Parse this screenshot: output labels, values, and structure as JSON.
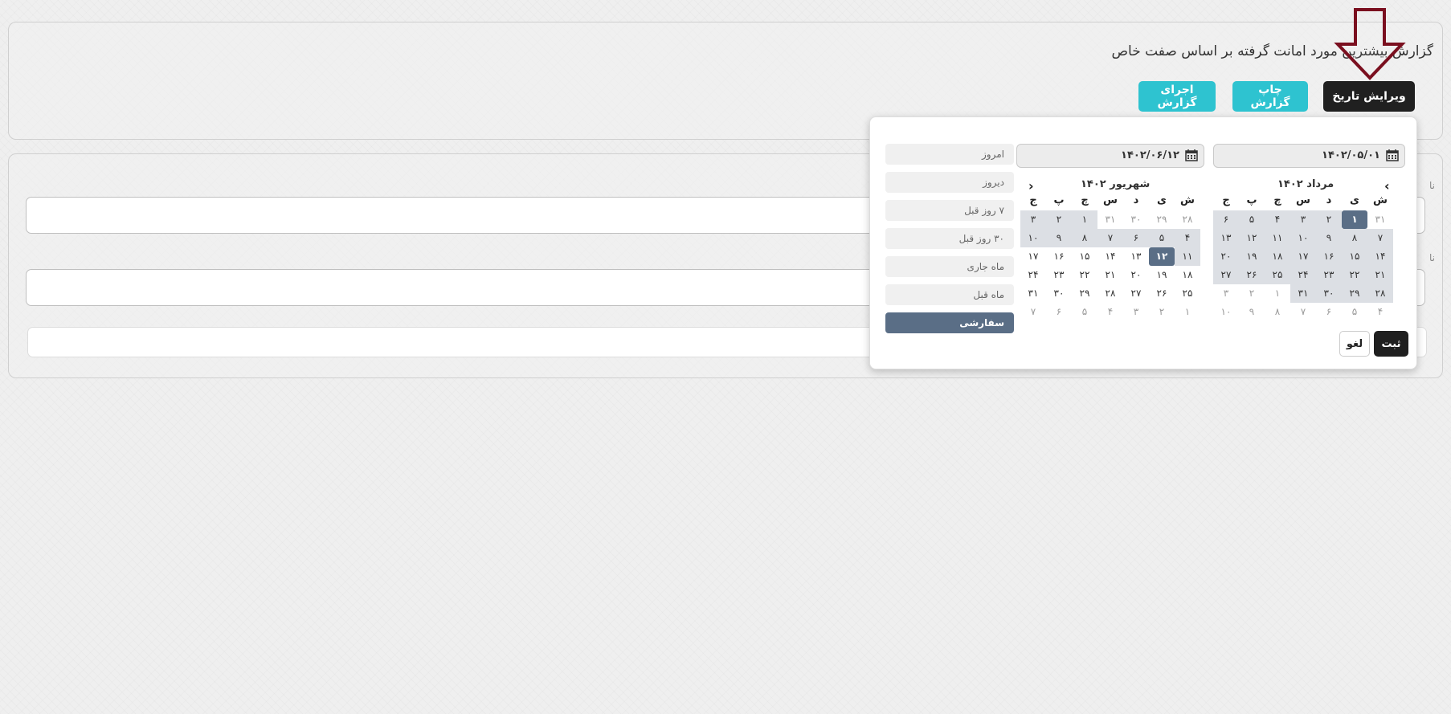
{
  "header": {
    "title": "گزارش بیشترین مورد امانت گرفته بر اساس صفت خاص"
  },
  "toolbar": {
    "edit_date_label": "ویرایش تاریخ",
    "print_label": "چاپ گزارش",
    "run_label": "اجرای گزارش"
  },
  "form": {
    "label_1": "نا",
    "label_2": "نا"
  },
  "datepicker": {
    "start_value": "۱۴۰۲/۰۵/۰۱",
    "end_value": "۱۴۰۲/۰۶/۱۲",
    "left_month_title": "مرداد ۱۴۰۲",
    "right_month_title": "شهریور ۱۴۰۲",
    "weekdays": [
      "ش",
      "ی",
      "د",
      "س",
      "چ",
      "پ",
      "ج"
    ],
    "left_month_weeks": [
      [
        "۳۱",
        "۱",
        "۲",
        "۳",
        "۴",
        "۵",
        "۶"
      ],
      [
        "۷",
        "۸",
        "۹",
        "۱۰",
        "۱۱",
        "۱۲",
        "۱۳"
      ],
      [
        "۱۴",
        "۱۵",
        "۱۶",
        "۱۷",
        "۱۸",
        "۱۹",
        "۲۰"
      ],
      [
        "۲۱",
        "۲۲",
        "۲۳",
        "۲۴",
        "۲۵",
        "۲۶",
        "۲۷"
      ],
      [
        "۲۸",
        "۲۹",
        "۳۰",
        "۳۱",
        "۱",
        "۲",
        "۳"
      ],
      [
        "۴",
        "۵",
        "۶",
        "۷",
        "۸",
        "۹",
        "۱۰"
      ]
    ],
    "right_month_weeks": [
      [
        "۲۸",
        "۲۹",
        "۳۰",
        "۳۱",
        "۱",
        "۲",
        "۳"
      ],
      [
        "۴",
        "۵",
        "۶",
        "۷",
        "۸",
        "۹",
        "۱۰"
      ],
      [
        "۱۱",
        "۱۲",
        "۱۳",
        "۱۴",
        "۱۵",
        "۱۶",
        "۱۷"
      ],
      [
        "۱۸",
        "۱۹",
        "۲۰",
        "۲۱",
        "۲۲",
        "۲۳",
        "۲۴"
      ],
      [
        "۲۵",
        "۲۶",
        "۲۷",
        "۲۸",
        "۲۹",
        "۳۰",
        "۳۱"
      ],
      [
        "۱",
        "۲",
        "۳",
        "۴",
        "۵",
        "۶",
        "۷"
      ]
    ],
    "ranges": [
      "امروز",
      "دیروز",
      "۷ روز قبل",
      "۳۰ روز قبل",
      "ماه جاری",
      "ماه قبل",
      "سفارشی"
    ],
    "active_range": "سفارشی",
    "apply_label": "ثبت",
    "cancel_label": "لغو"
  },
  "colors": {
    "accent": "#2ec3d0",
    "dark_button": "#202020",
    "selected_day": "#5a6e86",
    "range_highlight": "#dcdfe4",
    "arrow_annotation": "#7a0f1f"
  },
  "icons": [
    "calendar-icon",
    "chevron-left-icon",
    "chevron-right-icon",
    "down-arrow-annotation-icon"
  ]
}
